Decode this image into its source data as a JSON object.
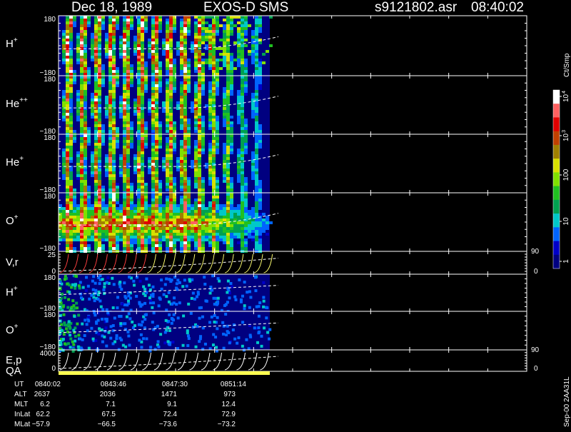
{
  "header": {
    "date": "Dec 18, 1989",
    "mission": "EXOS-D SMS",
    "file": "s9121802.asr",
    "time": "08:40:02"
  },
  "colorbar": {
    "units": "Ct/Smp",
    "tick_labels": [
      "1",
      "10",
      "100",
      "10",
      "10"
    ],
    "tick_exponents": [
      "",
      "",
      "",
      "3",
      "4"
    ],
    "colors": [
      "#000080",
      "#0000c8",
      "#0064ff",
      "#00c8c8",
      "#00a050",
      "#20c020",
      "#80e000",
      "#d8e000",
      "#a08000",
      "#c04000",
      "#e00000",
      "#ff6060",
      "#ffffff"
    ]
  },
  "panels": [
    {
      "id": "h-plus",
      "label": "H",
      "sup": "+",
      "ymax": "180",
      "ymin": "−180"
    },
    {
      "id": "he-plus-plus",
      "label": "He",
      "sup": "++",
      "ymax": "180",
      "ymin": "−180"
    },
    {
      "id": "he-plus",
      "label": "He",
      "sup": "+",
      "ymax": "180",
      "ymin": "−180"
    },
    {
      "id": "o-plus",
      "label": "O",
      "sup": "+",
      "ymax": "180",
      "ymin": "−180"
    },
    {
      "id": "v-r",
      "label": "V,r",
      "sup": "",
      "ymax": "25",
      "ymin": "0",
      "right_top": "90",
      "right_bottom": "0"
    },
    {
      "id": "h-plus-2",
      "label": "H",
      "sup": "+",
      "ymax": "180",
      "ymin": "−180"
    },
    {
      "id": "o-plus-2",
      "label": "O",
      "sup": "+",
      "ymax": "180",
      "ymin": "−180"
    },
    {
      "id": "e-p",
      "label": "E,p",
      "sup": "",
      "ymax": "4000",
      "ymin": "0",
      "right_top": "90",
      "right_bottom": "0"
    }
  ],
  "qa_label": "QA",
  "footer": {
    "rows": [
      {
        "name": "UT",
        "values": [
          "0840:02",
          "0843:46",
          "0847:30",
          "0851:14"
        ]
      },
      {
        "name": "ALT",
        "values": [
          "2637",
          "2036",
          "1471",
          "973"
        ]
      },
      {
        "name": "MLT",
        "values": [
          "6.2",
          "7.1",
          "9.1",
          "12.4"
        ]
      },
      {
        "name": "InLat",
        "values": [
          "62.2",
          "67.5",
          "72.4",
          "72.9"
        ]
      },
      {
        "name": "MLat",
        "values": [
          "−57.9",
          "−66.5",
          "−73.6",
          "−73.2"
        ]
      }
    ],
    "side_note": "Sep-00 2AA31L"
  },
  "chart_data": {
    "type": "heatmap",
    "description_scope": "pitch-angle spectrogram panels",
    "x_ticks": [
      "0840:02",
      "0843:46",
      "0847:30",
      "0851:14"
    ],
    "y_range_pitch": [
      -180,
      180
    ],
    "colorbar_range": [
      1,
      10000
    ],
    "colorbar_scale": "log",
    "vr_range": [
      0,
      25
    ],
    "ep_range": [
      0,
      4000
    ],
    "right_axis_range": [
      0,
      90
    ],
    "qa_color": "#ffff50"
  }
}
